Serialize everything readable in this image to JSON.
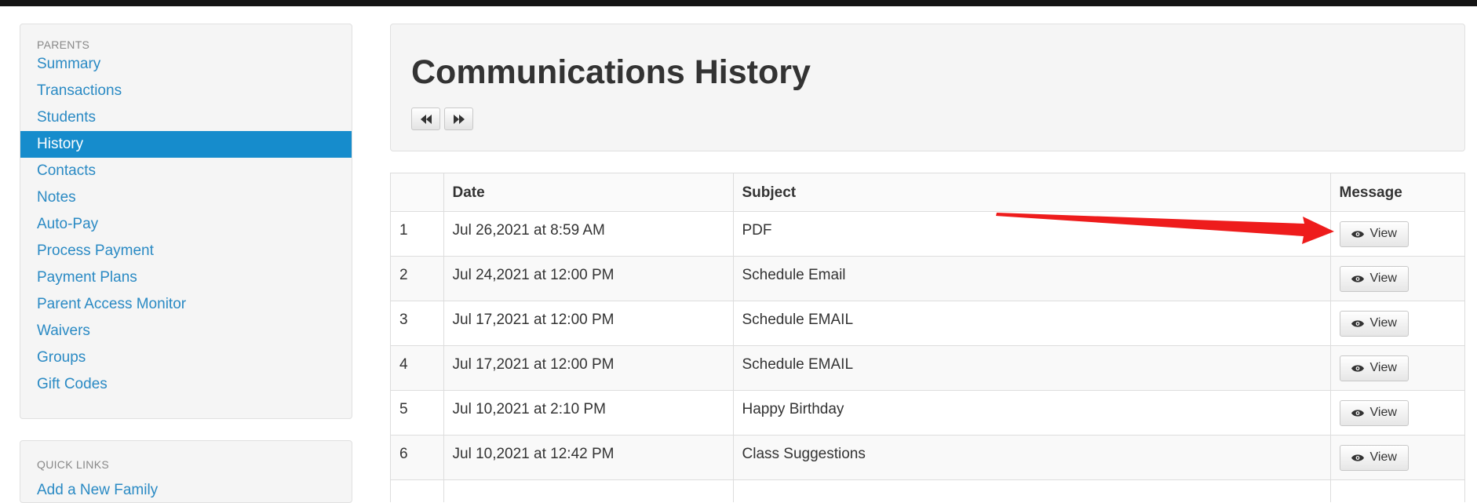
{
  "sidebar": {
    "section_title": "PARENTS",
    "items": [
      {
        "label": "Summary",
        "active": false
      },
      {
        "label": "Transactions",
        "active": false
      },
      {
        "label": "Students",
        "active": false
      },
      {
        "label": "History",
        "active": true
      },
      {
        "label": "Contacts",
        "active": false
      },
      {
        "label": "Notes",
        "active": false
      },
      {
        "label": "Auto-Pay",
        "active": false
      },
      {
        "label": "Process Payment",
        "active": false
      },
      {
        "label": "Payment Plans",
        "active": false
      },
      {
        "label": "Parent Access Monitor",
        "active": false
      },
      {
        "label": "Waivers",
        "active": false
      },
      {
        "label": "Groups",
        "active": false
      },
      {
        "label": "Gift Codes",
        "active": false
      }
    ],
    "quick_links_title": "QUICK LINKS",
    "quick_links_first": "Add a New Family"
  },
  "header": {
    "title": "Communications History",
    "prev_icon": "fast-backward-icon",
    "next_icon": "fast-forward-icon"
  },
  "table": {
    "columns": [
      "",
      "Date",
      "Subject",
      "Message"
    ],
    "rows": [
      {
        "num": "1",
        "date": "Jul 26,2021 at 8:59 AM",
        "subject": "PDF",
        "action": "View"
      },
      {
        "num": "2",
        "date": "Jul 24,2021 at 12:00 PM",
        "subject": "Schedule Email",
        "action": "View"
      },
      {
        "num": "3",
        "date": "Jul 17,2021 at 12:00 PM",
        "subject": "Schedule EMAIL",
        "action": "View"
      },
      {
        "num": "4",
        "date": "Jul 17,2021 at 12:00 PM",
        "subject": "Schedule EMAIL",
        "action": "View"
      },
      {
        "num": "5",
        "date": "Jul 10,2021 at 2:10 PM",
        "subject": "Happy Birthday",
        "action": "View"
      },
      {
        "num": "6",
        "date": "Jul 10,2021 at 12:42 PM",
        "subject": "Class Suggestions",
        "action": "View"
      }
    ],
    "view_icon": "eye-icon"
  },
  "annotation": {
    "type": "red-arrow",
    "target": "row-1-view-button",
    "color": "#ee1c1c"
  },
  "colors": {
    "accent": "#168ccc",
    "link": "#2a8ac4",
    "topbar": "#141414",
    "panel_bg": "#f5f5f5"
  }
}
